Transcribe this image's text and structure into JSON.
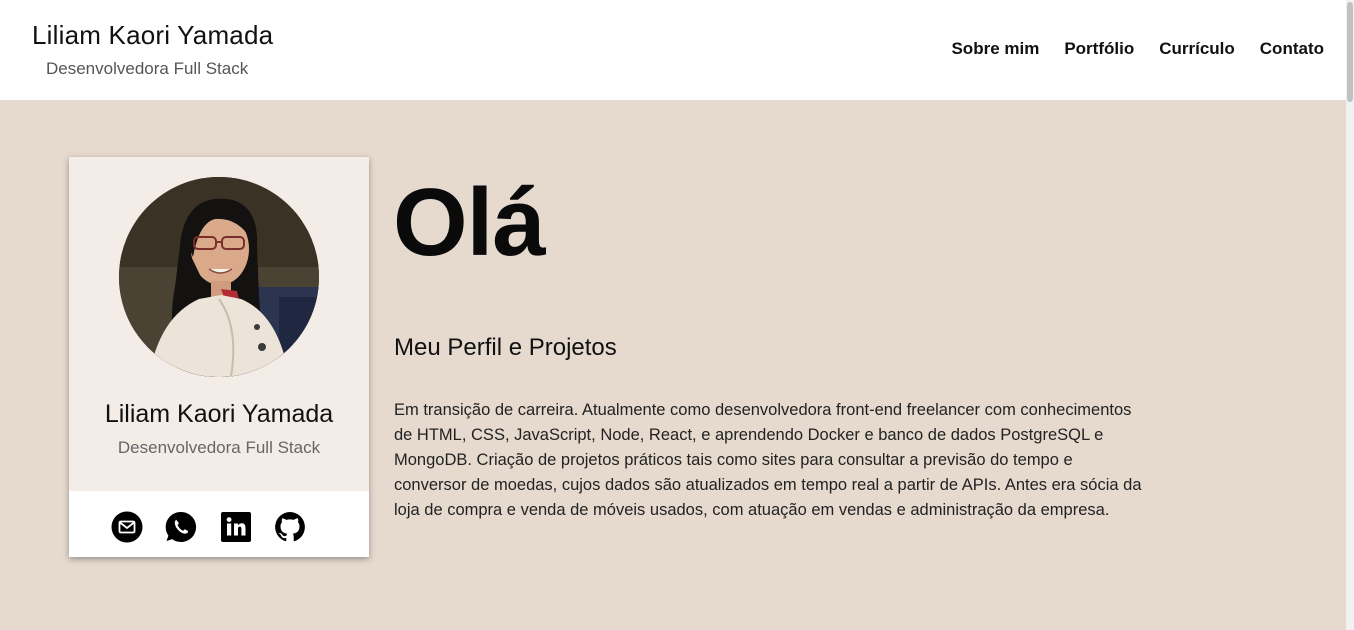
{
  "header": {
    "name": "Liliam Kaori Yamada",
    "role": "Desenvolvedora Full Stack",
    "nav": [
      "Sobre mim",
      "Portfólio",
      "Currículo",
      "Contato"
    ]
  },
  "card": {
    "name": "Liliam Kaori Yamada",
    "role": "Desenvolvedora Full Stack",
    "social": [
      "mail-icon",
      "whatsapp-icon",
      "linkedin-icon",
      "github-icon"
    ]
  },
  "main": {
    "hello": "Olá",
    "subtitle": "Meu Perfil e Projetos",
    "bio": "Em transição de carreira. Atualmente como desenvolvedora front-end freelancer com conhecimentos de HTML, CSS, JavaScript, Node, React, e aprendendo Docker e banco de dados PostgreSQL e MongoDB. Criação de projetos práticos tais como sites para consultar a previsão do tempo e conversor de moedas, cujos dados são atualizados em tempo real a partir de APIs. Antes era sócia da loja de compra e venda de móveis usados, com atuação em vendas e administração da empresa."
  },
  "colors": {
    "page_background": "#e6dacf",
    "card_background": "#f3ece7",
    "header_background": "#ffffff"
  }
}
